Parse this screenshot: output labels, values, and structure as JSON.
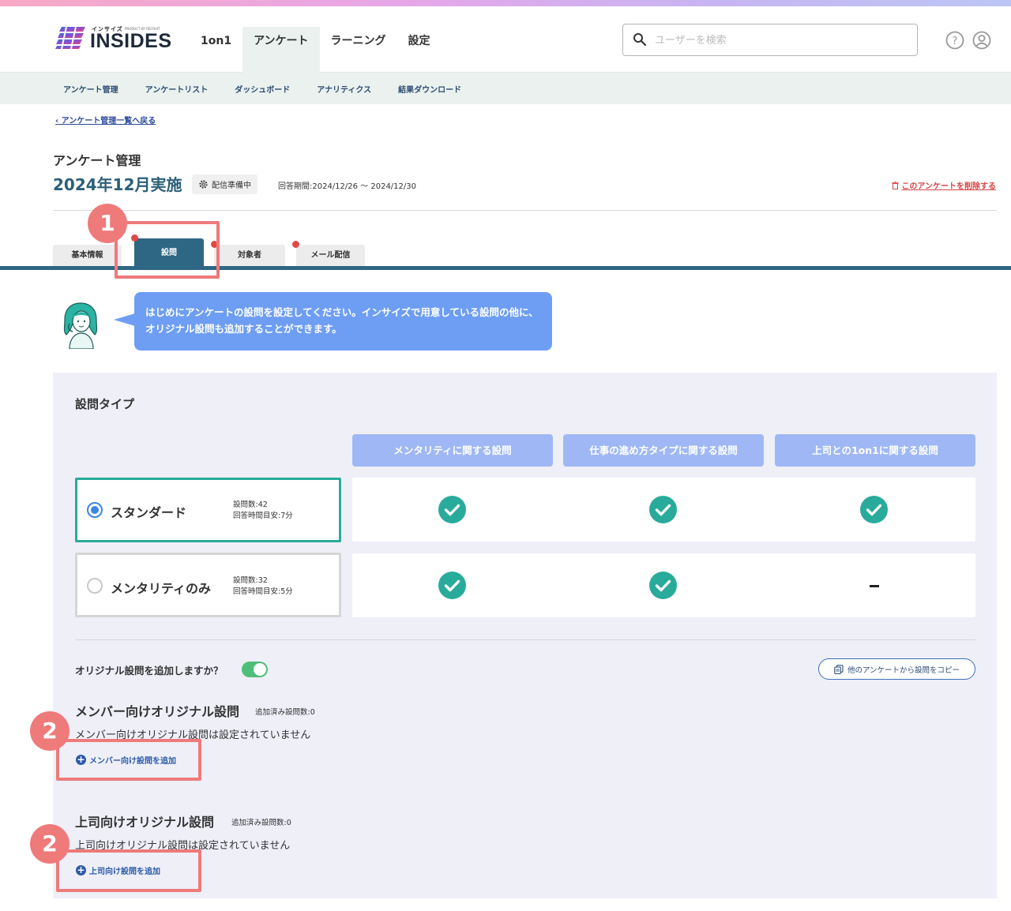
{
  "brand": {
    "small_label": "インサイズ",
    "tiny_label": "PRODUCT BY RECRUIT",
    "name": "INSIDES"
  },
  "nav": {
    "items": [
      {
        "label": "1on1"
      },
      {
        "label": "アンケート"
      },
      {
        "label": "ラーニング"
      },
      {
        "label": "設定"
      }
    ]
  },
  "search": {
    "placeholder": "ユーザーを検索",
    "value": ""
  },
  "subnav": {
    "items": [
      {
        "label": "アンケート管理"
      },
      {
        "label": "アンケートリスト"
      },
      {
        "label": "ダッシュボード"
      },
      {
        "label": "アナリティクス"
      },
      {
        "label": "結果ダウンロード"
      }
    ]
  },
  "back_link": "‹ アンケート管理一覧へ戻る",
  "page": {
    "label": "アンケート管理",
    "title": "2024年12月実施",
    "status": "配信準備中",
    "period": "回答期間:2024/12/26 〜 2024/12/30",
    "delete_label": "このアンケートを削除する"
  },
  "tabs": [
    {
      "label": "基本情報"
    },
    {
      "label": "設問"
    },
    {
      "label": "対象者"
    },
    {
      "label": "メール配信"
    }
  ],
  "callouts": {
    "one": "1",
    "two": "2"
  },
  "guide_message": "はじめにアンケートの設問を設定してください。インサイズで用意している設問の他に、オリジナル設問も追加することができます。",
  "question_type": {
    "title": "設問タイプ",
    "columns": [
      {
        "label": "メンタリティに関する設問"
      },
      {
        "label": "仕事の進め方タイプに関する設問"
      },
      {
        "label": "上司との1on1に関する設問"
      }
    ],
    "options": [
      {
        "name": "スタンダード",
        "count": "設問数:42",
        "time": "回答時間目安:7分",
        "selected": true,
        "includes": [
          true,
          true,
          true
        ]
      },
      {
        "name": "メンタリティのみ",
        "count": "設問数:32",
        "time": "回答時間目安:5分",
        "selected": false,
        "includes": [
          true,
          true,
          false
        ],
        "none_mark": "-"
      }
    ]
  },
  "original": {
    "question": "オリジナル設問を追加しますか？",
    "enabled": true,
    "copy_button": "他のアンケートから設問をコピー",
    "member": {
      "title": "メンバー向けオリジナル設問",
      "count": "追加済み設問数:0",
      "empty": "メンバー向けオリジナル設問は設定されていません",
      "add_label": "メンバー向け設問を追加"
    },
    "boss": {
      "title": "上司向けオリジナル設問",
      "count": "追加済み設問数:0",
      "empty": "上司向けオリジナル設問は設定されていません",
      "add_label": "上司向け設問を追加"
    }
  },
  "colors": {
    "accent": "#2e6783",
    "check": "#29ab9b",
    "callout": "#ee7a7a",
    "bubble": "#6e9ef3",
    "column_header": "#9fb8f5"
  },
  "icons": [
    "search-icon",
    "help-icon",
    "user-icon",
    "gear-icon",
    "trash-icon",
    "check-circle-icon",
    "copy-icon",
    "plus-circle-icon"
  ]
}
